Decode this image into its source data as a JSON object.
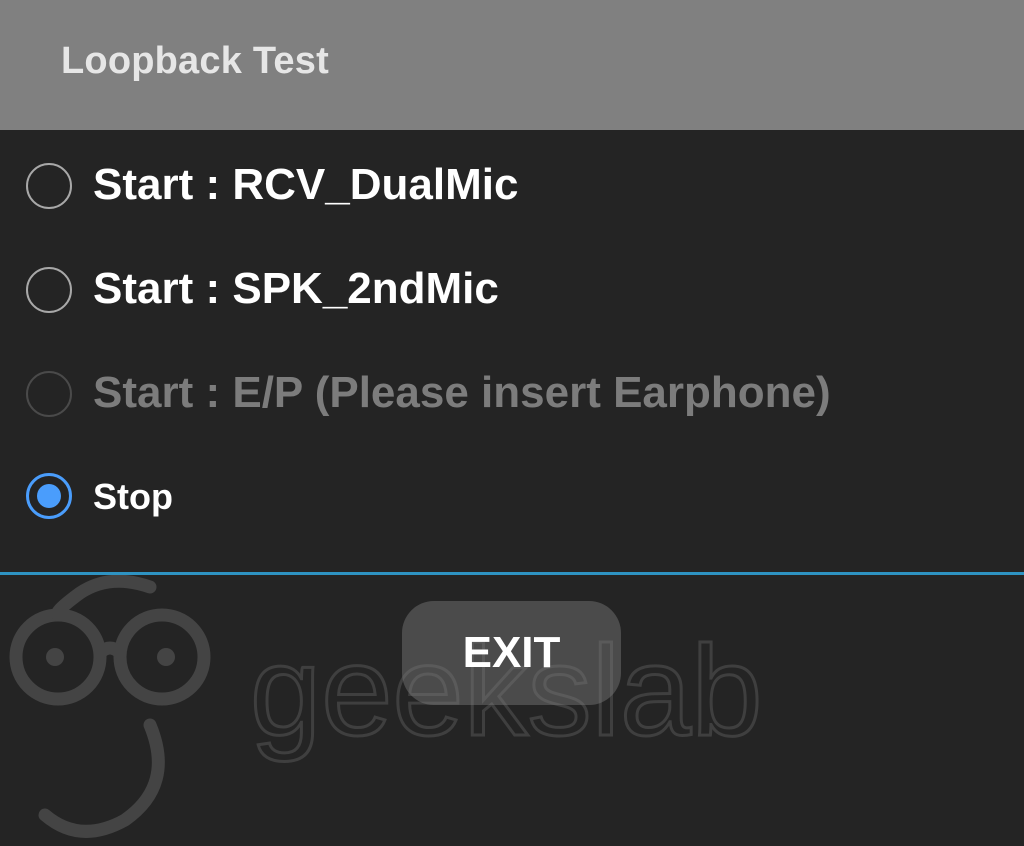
{
  "dialog": {
    "title": "Loopback Test"
  },
  "options": [
    {
      "label": "Start : RCV_DualMic",
      "checked": false,
      "enabled": true
    },
    {
      "label": "Start : SPK_2ndMic",
      "checked": false,
      "enabled": true
    },
    {
      "label": "Start : E/P (Please insert Earphone)",
      "checked": false,
      "enabled": false
    },
    {
      "label": "Stop",
      "checked": true,
      "enabled": true
    }
  ],
  "exit_button": {
    "label": "EXIT"
  },
  "watermark": {
    "text": "geekslab"
  },
  "colors": {
    "background": "#242424",
    "titlebar": "#808080",
    "accent": "#4a9dfc",
    "divider": "#2e93c2"
  }
}
